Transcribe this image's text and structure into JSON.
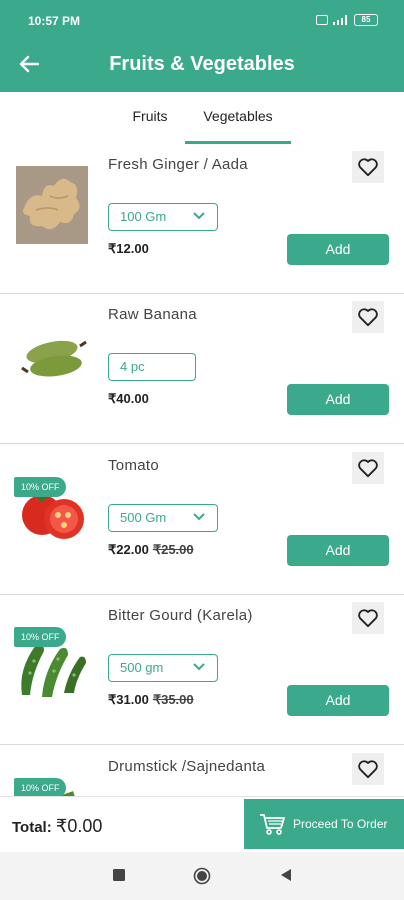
{
  "status": {
    "time": "10:57 PM",
    "battery": "85"
  },
  "header": {
    "title": "Fruits & Vegetables"
  },
  "tabs": [
    {
      "label": "Fruits"
    },
    {
      "label": "Vegetables"
    }
  ],
  "products": [
    {
      "name": "Fresh Ginger / Aada",
      "variant": "100 Gm",
      "price": "₹12.00"
    },
    {
      "name": "Raw Banana",
      "variant": "4 pc",
      "price": "₹40.00"
    },
    {
      "name": "Tomato",
      "variant": "500 Gm",
      "price": "₹22.00",
      "mrp": "₹25.00",
      "badge": "10% OFF"
    },
    {
      "name": "Bitter Gourd (Karela)",
      "variant": "500 gm",
      "price": "₹31.00",
      "mrp": "₹35.00",
      "badge": "10% OFF"
    },
    {
      "name": "Drumstick /Sajnedanta",
      "badge": "10% OFF"
    }
  ],
  "add_label": "Add",
  "footer": {
    "total_label": "Total:",
    "total_value": "₹0.00",
    "proceed_label": "Proceed To Order"
  },
  "colors": {
    "accent": "#3ba98c"
  }
}
